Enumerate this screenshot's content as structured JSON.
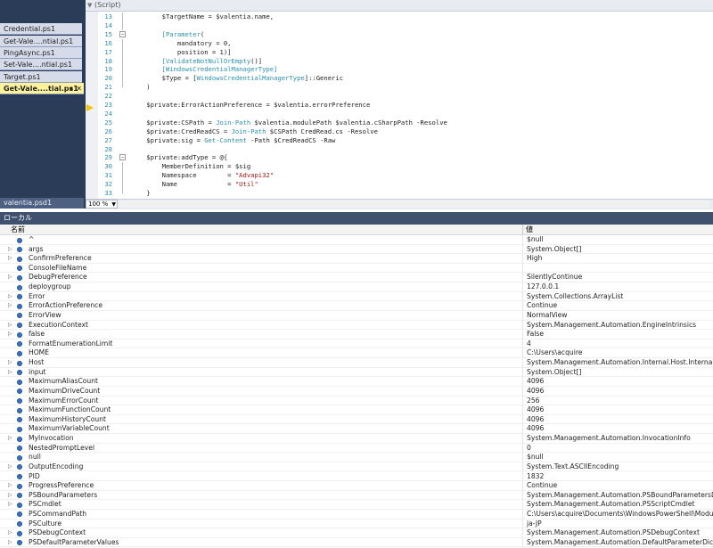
{
  "editor": {
    "scope": "(Script)",
    "zoom": "100 %",
    "lines": [
      {
        "num": "13",
        "outline": "line",
        "text": [
          [
            "var",
            "        $TargetName = $valentia.name,"
          ]
        ]
      },
      {
        "num": "14",
        "outline": "line",
        "text": [
          [
            "var",
            ""
          ]
        ]
      },
      {
        "num": "15",
        "outline": "box",
        "text": [
          [
            "var",
            "        "
          ],
          [
            "bracket",
            "[Parameter"
          ],
          [
            "var",
            "("
          ]
        ]
      },
      {
        "num": "16",
        "outline": "line",
        "text": [
          [
            "var",
            "            mandatory = 0,"
          ]
        ]
      },
      {
        "num": "17",
        "outline": "line",
        "text": [
          [
            "var",
            "            position = 1)]"
          ]
        ]
      },
      {
        "num": "18",
        "outline": "line",
        "text": [
          [
            "var",
            "        "
          ],
          [
            "bracket",
            "[ValidateNotNullOrEmpty"
          ],
          [
            "var",
            "()]"
          ]
        ]
      },
      {
        "num": "19",
        "outline": "line",
        "text": [
          [
            "var",
            "        "
          ],
          [
            "bracket",
            "[WindowsCredentialManagerType]"
          ]
        ]
      },
      {
        "num": "20",
        "outline": "line",
        "text": [
          [
            "var",
            "        $Type = ["
          ],
          [
            "type",
            "WindowsCredentialManagerType"
          ],
          [
            "var",
            "]::Generic"
          ]
        ]
      },
      {
        "num": "21",
        "outline": "end",
        "text": [
          [
            "var",
            "    )"
          ]
        ]
      },
      {
        "num": "22",
        "outline": "none",
        "text": [
          [
            "var",
            ""
          ]
        ]
      },
      {
        "num": "23",
        "outline": "none",
        "text": [
          [
            "var",
            "    $private:ErrorActionPreference = $valentia.errorPreference"
          ]
        ]
      },
      {
        "num": "24",
        "outline": "none",
        "text": [
          [
            "var",
            ""
          ]
        ]
      },
      {
        "num": "25",
        "outline": "none",
        "text": [
          [
            "var",
            "    $private:CSPath = "
          ],
          [
            "cmd",
            "Join-Path"
          ],
          [
            "var",
            " $valentia.modulePath $valentia.cSharpPath -Resolve"
          ]
        ]
      },
      {
        "num": "26",
        "outline": "none",
        "text": [
          [
            "var",
            "    $private:CredReadCS = "
          ],
          [
            "cmd",
            "Join-Path"
          ],
          [
            "var",
            " $CSPath CredRead.cs -Resolve"
          ]
        ]
      },
      {
        "num": "27",
        "outline": "none",
        "text": [
          [
            "var",
            "    $private:sig = "
          ],
          [
            "cmd",
            "Get-Content"
          ],
          [
            "var",
            " -Path $CredReadCS -Raw"
          ]
        ]
      },
      {
        "num": "28",
        "outline": "none",
        "text": [
          [
            "var",
            ""
          ]
        ]
      },
      {
        "num": "29",
        "outline": "box",
        "text": [
          [
            "var",
            "    $private:addType = @{"
          ]
        ]
      },
      {
        "num": "30",
        "outline": "line",
        "text": [
          [
            "var",
            "        MemberDefinition = $sig"
          ]
        ]
      },
      {
        "num": "31",
        "outline": "line",
        "text": [
          [
            "var",
            "        Namespace        = "
          ],
          [
            "str",
            "\"Advapi32\""
          ]
        ]
      },
      {
        "num": "32",
        "outline": "line",
        "text": [
          [
            "var",
            "        Name             = "
          ],
          [
            "str",
            "\"Util\""
          ]
        ]
      },
      {
        "num": "33",
        "outline": "end",
        "text": [
          [
            "var",
            "    }"
          ]
        ]
      }
    ]
  },
  "tabs": [
    {
      "label": "Credential.ps1",
      "active": false
    },
    {
      "label": "Get-Vale....ntial.ps1",
      "active": false
    },
    {
      "label": "PingAsync.ps1",
      "active": false
    },
    {
      "label": "Set-Vale....ntial.ps1",
      "active": false
    },
    {
      "label": "Target.ps1",
      "active": false
    },
    {
      "label": "Get-Vale....tial.ps1",
      "active": true
    }
  ],
  "bottom_tab": "valentia.psd1",
  "locals": {
    "title": "ローカル",
    "col_name": "名前",
    "col_value": "値",
    "rows": [
      {
        "name": "^",
        "value": "$null",
        "expandable": false
      },
      {
        "name": "args",
        "value": "System.Object[]",
        "expandable": true
      },
      {
        "name": "ConfirmPreference",
        "value": "High",
        "expandable": true
      },
      {
        "name": "ConsoleFileName",
        "value": "",
        "expandable": false
      },
      {
        "name": "DebugPreference",
        "value": "SilentlyContinue",
        "expandable": true
      },
      {
        "name": "deploygroup",
        "value": "127.0.0.1",
        "expandable": false
      },
      {
        "name": "Error",
        "value": "System.Collections.ArrayList",
        "expandable": true
      },
      {
        "name": "ErrorActionPreference",
        "value": "Continue",
        "expandable": true
      },
      {
        "name": "ErrorView",
        "value": "NormalView",
        "expandable": false
      },
      {
        "name": "ExecutionContext",
        "value": "System.Management.Automation.EngineIntrinsics",
        "expandable": true
      },
      {
        "name": "false",
        "value": "False",
        "expandable": true
      },
      {
        "name": "FormatEnumerationLimit",
        "value": "4",
        "expandable": false
      },
      {
        "name": "HOME",
        "value": "C:\\Users\\acquire",
        "expandable": false
      },
      {
        "name": "Host",
        "value": "System.Management.Automation.Internal.Host.InternalHost",
        "expandable": true
      },
      {
        "name": "input",
        "value": "System.Object[]",
        "expandable": true
      },
      {
        "name": "MaximumAliasCount",
        "value": "4096",
        "expandable": false
      },
      {
        "name": "MaximumDriveCount",
        "value": "4096",
        "expandable": false
      },
      {
        "name": "MaximumErrorCount",
        "value": "256",
        "expandable": false
      },
      {
        "name": "MaximumFunctionCount",
        "value": "4096",
        "expandable": false
      },
      {
        "name": "MaximumHistoryCount",
        "value": "4096",
        "expandable": false
      },
      {
        "name": "MaximumVariableCount",
        "value": "4096",
        "expandable": false
      },
      {
        "name": "MyInvocation",
        "value": "System.Management.Automation.InvocationInfo",
        "expandable": true
      },
      {
        "name": "NestedPromptLevel",
        "value": "0",
        "expandable": false
      },
      {
        "name": "null",
        "value": "$null",
        "expandable": false
      },
      {
        "name": "OutputEncoding",
        "value": "System.Text.ASCIIEncoding",
        "expandable": true
      },
      {
        "name": "PID",
        "value": "1832",
        "expandable": false
      },
      {
        "name": "ProgressPreference",
        "value": "Continue",
        "expandable": true
      },
      {
        "name": "PSBoundParameters",
        "value": "System.Management.Automation.PSBoundParametersDictiona",
        "expandable": true
      },
      {
        "name": "PSCmdlet",
        "value": "System.Management.Automation.PSScriptCmdlet",
        "expandable": true
      },
      {
        "name": "PSCommandPath",
        "value": "C:\\Users\\acquire\\Documents\\WindowsPowerShell\\Modules\\Va",
        "expandable": false
      },
      {
        "name": "PSCulture",
        "value": "ja-JP",
        "expandable": false
      },
      {
        "name": "PSDebugContext",
        "value": "System.Management.Automation.PSDebugContext",
        "expandable": true
      },
      {
        "name": "PSDefaultParameterValues",
        "value": "System.Management.Automation.DefaultParameterDictionary",
        "expandable": true
      }
    ]
  },
  "colors": {
    "tabstrip_bg": "#2b3c59",
    "active_tab": "#fff29d",
    "panel_title": "#405170",
    "line_number": "#2b91af",
    "string": "#a31515",
    "breakpoint_arrow": "#f5c400"
  },
  "icons": {
    "current_line": "current-line-arrow-icon",
    "variable": "variable-icon",
    "expand": "expand-triangle-icon"
  }
}
